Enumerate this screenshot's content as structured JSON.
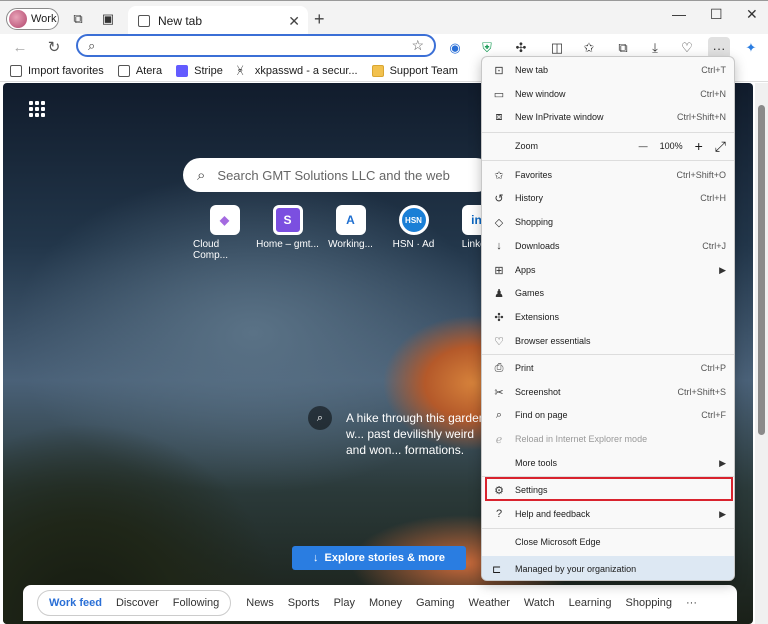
{
  "titlebar": {
    "profile_label": "Work",
    "tab_title": "New tab",
    "new_tab_symbol": "+",
    "minimize_symbol": "—",
    "maximize_symbol": "☐",
    "close_symbol": "✕",
    "tab_close_symbol": "✕"
  },
  "address_bar": {
    "value": "",
    "placeholder": ""
  },
  "bookmarks": [
    {
      "label": "Import favorites",
      "icon": "import-icon"
    },
    {
      "label": "Atera",
      "icon": "page-icon"
    },
    {
      "label": "Stripe",
      "icon": "stripe-icon",
      "color": "#635bff"
    },
    {
      "label": "xkpasswd - a secur...",
      "icon": "person-icon"
    },
    {
      "label": "Support Team",
      "icon": "folder-icon",
      "color": "#f2c14e"
    }
  ],
  "newtab_page": {
    "search_placeholder": "Search GMT Solutions LLC and the web",
    "tiles": [
      {
        "label": "Cloud Comp...",
        "glyph": "◆",
        "color": "#a46ae0"
      },
      {
        "label": "Home – gmt...",
        "glyph": "S",
        "color": "#7b4fe0"
      },
      {
        "label": "Working...",
        "glyph": "A",
        "color": "#1f6fd0"
      },
      {
        "label": "HSN · Ad",
        "glyph": "HSN",
        "color": "#1a7fd6"
      },
      {
        "label": "Linked",
        "glyph": "in",
        "color": "#0a66c2"
      }
    ],
    "caption": "A hike through this garden w... past devilishly weird and won... formations.",
    "explore_label": "Explore stories & more"
  },
  "feed": {
    "primary": [
      "Work feed",
      "Discover",
      "Following"
    ],
    "topics": [
      "News",
      "Sports",
      "Play",
      "Money",
      "Gaming",
      "Weather",
      "Watch",
      "Learning",
      "Shopping",
      "···"
    ]
  },
  "menu": {
    "new_tab": {
      "label": "New tab",
      "shortcut": "Ctrl+T"
    },
    "new_window": {
      "label": "New window",
      "shortcut": "Ctrl+N"
    },
    "new_inprivate": {
      "label": "New InPrivate window",
      "shortcut": "Ctrl+Shift+N"
    },
    "zoom": {
      "label": "Zoom",
      "minus": "—",
      "value": "100%",
      "plus": "+",
      "fullscreen": "⤢"
    },
    "favorites": {
      "label": "Favorites",
      "shortcut": "Ctrl+Shift+O"
    },
    "history": {
      "label": "History",
      "shortcut": "Ctrl+H"
    },
    "shopping": {
      "label": "Shopping"
    },
    "downloads": {
      "label": "Downloads",
      "shortcut": "Ctrl+J"
    },
    "apps": {
      "label": "Apps"
    },
    "games": {
      "label": "Games"
    },
    "extensions": {
      "label": "Extensions"
    },
    "browser_essentials": {
      "label": "Browser essentials"
    },
    "print": {
      "label": "Print",
      "shortcut": "Ctrl+P"
    },
    "screenshot": {
      "label": "Screenshot",
      "shortcut": "Ctrl+Shift+S"
    },
    "find_on_page": {
      "label": "Find on page",
      "shortcut": "Ctrl+F"
    },
    "ie_mode": {
      "label": "Reload in Internet Explorer mode"
    },
    "more_tools": {
      "label": "More tools"
    },
    "settings": {
      "label": "Settings"
    },
    "help": {
      "label": "Help and feedback"
    },
    "close_edge": {
      "label": "Close Microsoft Edge"
    },
    "managed": {
      "label": "Managed by your organization"
    }
  },
  "colors": {
    "accent": "#3b6fd6",
    "highlight_outline": "#d9232e",
    "explore_button": "#2a7de1"
  }
}
